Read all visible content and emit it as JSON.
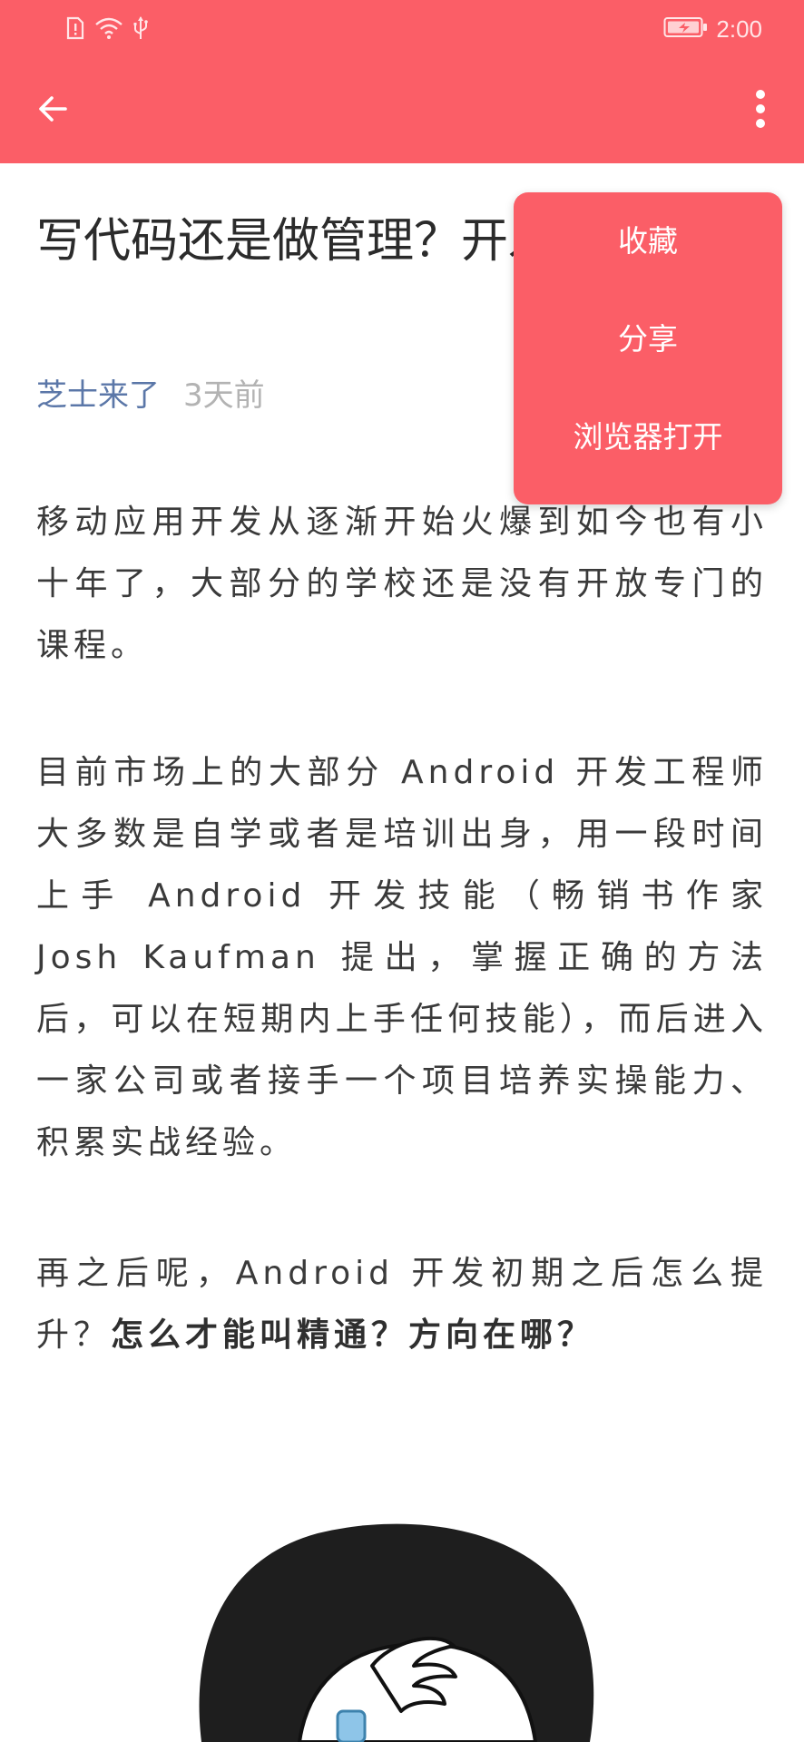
{
  "status_bar": {
    "time": "2:00",
    "icons": [
      "sim-alert-icon",
      "wifi-icon",
      "usb-icon",
      "battery-charging-icon"
    ]
  },
  "toolbar": {
    "back_icon": "arrow-left-icon",
    "more_icon": "more-vertical-icon"
  },
  "article": {
    "title": "写代码还是做管理？开发者的困扰",
    "author": "芝士来了",
    "time_ago": "3天前",
    "paragraphs": [
      "移动应用开发从逐渐开始火爆到如今也有小十年了，大部分的学校还是没有开放专门的课程。",
      "目前市场上的大部分 Android 开发工程师大多数是自学或者是培训出身，用一段时间上手 Android 开发技能（畅销书作家 Josh Kaufman 提出，掌握正确的方法后，可以在短期内上手任何技能），而后进入一家公司或者接手一个项目培养实操能力、积累实战经验。"
    ],
    "paragraph3_lead": "再之后呢，Android 开发初期之后怎么提升？",
    "paragraph3_bold": "怎么才能叫精通？方向在哪？"
  },
  "popup_menu": {
    "items": [
      {
        "label": "收藏"
      },
      {
        "label": "分享"
      },
      {
        "label": "浏览器打开"
      }
    ]
  },
  "colors": {
    "accent": "#fb5e67",
    "author": "#5b77a8",
    "meta": "#b3b3b3",
    "text": "#3a3a3a"
  }
}
